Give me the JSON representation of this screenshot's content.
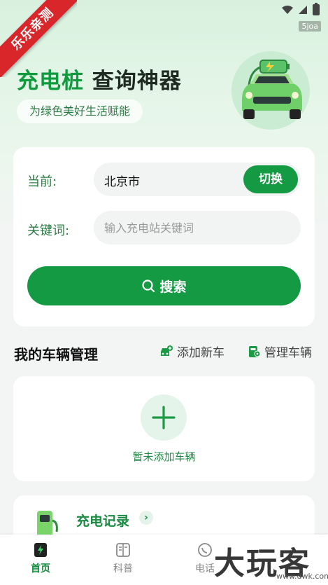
{
  "ribbon": {
    "text": "乐乐亲测"
  },
  "status_bar": {
    "tag": "5joa"
  },
  "hero": {
    "title_part1": "充电桩",
    "title_part2": "查询神器",
    "subtitle": "为绿色美好生活赋能"
  },
  "search": {
    "current_label": "当前:",
    "city_value": "北京市",
    "switch_label": "切换",
    "keyword_label": "关键词:",
    "keyword_placeholder": "输入充电站关键词",
    "keyword_value": "",
    "search_label": "搜索"
  },
  "vehicles": {
    "title": "我的车辆管理",
    "add_label": "添加新车",
    "manage_label": "管理车辆",
    "empty_text": "暂未添加车辆"
  },
  "record": {
    "title": "充电记录"
  },
  "nav": {
    "items": [
      {
        "label": "首页",
        "active": true
      },
      {
        "label": "科普",
        "active": false
      },
      {
        "label": "电话",
        "active": false
      }
    ]
  },
  "watermark": {
    "text": "大玩客",
    "sub": "www.dwk.com"
  },
  "colors": {
    "accent": "#139a43",
    "accent_light": "#e5f4ea",
    "ribbon": "#d9262b"
  }
}
